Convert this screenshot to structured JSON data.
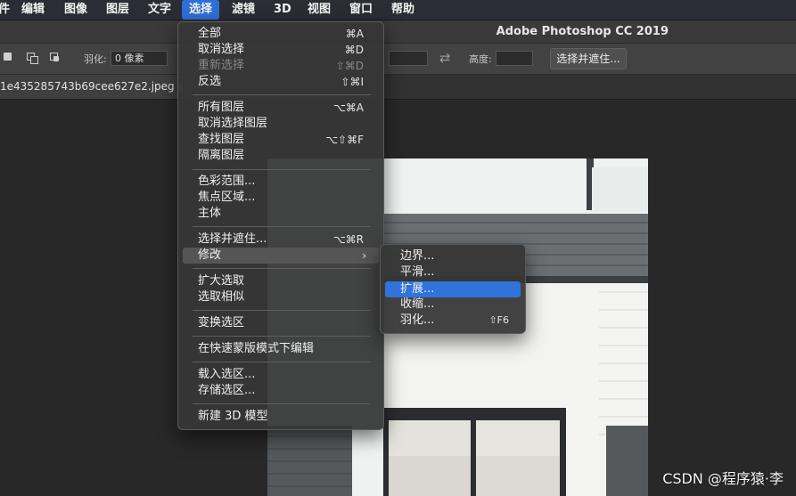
{
  "menubar": {
    "items": [
      {
        "label": "件",
        "active": false
      },
      {
        "label": "编辑",
        "active": false
      },
      {
        "label": "图像",
        "active": false
      },
      {
        "label": "图层",
        "active": false
      },
      {
        "label": "文字",
        "active": false
      },
      {
        "label": "选择",
        "active": true
      },
      {
        "label": "滤镜",
        "active": false
      },
      {
        "label": "3D",
        "active": false
      },
      {
        "label": "视图",
        "active": false
      },
      {
        "label": "窗口",
        "active": false
      },
      {
        "label": "帮助",
        "active": false
      }
    ]
  },
  "window": {
    "title": "Adobe Photoshop CC 2019"
  },
  "options_bar": {
    "feather_label": "羽化:",
    "feather_value": "0 像素",
    "height_label": "高度:",
    "refine_button": "选择并遮住..."
  },
  "document": {
    "tab_label": "1e435285743b69cee627e2.jpeg @"
  },
  "select_menu": {
    "groups": [
      [
        {
          "label": "全部",
          "shortcut": "⌘A",
          "disabled": false
        },
        {
          "label": "取消选择",
          "shortcut": "⌘D",
          "disabled": false
        },
        {
          "label": "重新选择",
          "shortcut": "⇧⌘D",
          "disabled": true
        },
        {
          "label": "反选",
          "shortcut": "⇧⌘I",
          "disabled": false
        }
      ],
      [
        {
          "label": "所有图层",
          "shortcut": "⌥⌘A",
          "disabled": false
        },
        {
          "label": "取消选择图层",
          "shortcut": "",
          "disabled": false
        },
        {
          "label": "查找图层",
          "shortcut": "⌥⇧⌘F",
          "disabled": false
        },
        {
          "label": "隔离图层",
          "shortcut": "",
          "disabled": false
        }
      ],
      [
        {
          "label": "色彩范围...",
          "shortcut": "",
          "disabled": false
        },
        {
          "label": "焦点区域...",
          "shortcut": "",
          "disabled": false
        },
        {
          "label": "主体",
          "shortcut": "",
          "disabled": false
        }
      ],
      [
        {
          "label": "选择并遮住...",
          "shortcut": "⌥⌘R",
          "disabled": false
        },
        {
          "label": "修改",
          "shortcut": "",
          "disabled": false,
          "submenu": true,
          "highlighted": true
        }
      ],
      [
        {
          "label": "扩大选取",
          "shortcut": "",
          "disabled": false
        },
        {
          "label": "选取相似",
          "shortcut": "",
          "disabled": false
        }
      ],
      [
        {
          "label": "变换选区",
          "shortcut": "",
          "disabled": false
        }
      ],
      [
        {
          "label": "在快速蒙版模式下编辑",
          "shortcut": "",
          "disabled": false
        }
      ],
      [
        {
          "label": "载入选区...",
          "shortcut": "",
          "disabled": false
        },
        {
          "label": "存储选区...",
          "shortcut": "",
          "disabled": false
        }
      ],
      [
        {
          "label": "新建 3D 模型",
          "shortcut": "",
          "disabled": false
        }
      ]
    ]
  },
  "modify_submenu": {
    "items": [
      {
        "label": "边界...",
        "shortcut": "",
        "highlighted": false
      },
      {
        "label": "平滑...",
        "shortcut": "",
        "highlighted": false
      },
      {
        "label": "扩展...",
        "shortcut": "",
        "highlighted": true
      },
      {
        "label": "收缩...",
        "shortcut": "",
        "highlighted": false
      },
      {
        "label": "羽化...",
        "shortcut": "⇧F6",
        "highlighted": false
      }
    ]
  },
  "watermark": "CSDN @程序猿·李",
  "colors": {
    "menu_highlight": "#2f73db",
    "menubar_bg": "#2a2d34",
    "canvas_bg": "#282828"
  }
}
